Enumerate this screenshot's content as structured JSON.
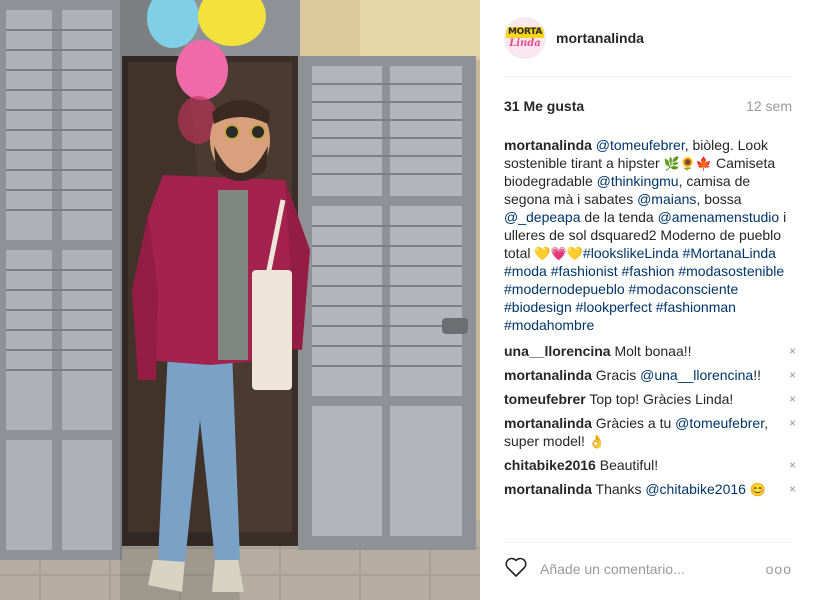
{
  "post": {
    "username": "mortanalinda",
    "avatar_top": "MORTA",
    "avatar_bottom": "Linda",
    "likes": "31 Me gusta",
    "age": "12 sem"
  },
  "caption": {
    "user": "mortanalinda",
    "m1": "@tomeufebrer",
    "t1": ", biòleg. Look sostenible tirant a hipster ",
    "e1": "🌿🌻🍁",
    "t2": " Camiseta biodegradable ",
    "m2": "@thinkingmu",
    "t3": ", camisa de segona mà i sabates ",
    "m3": "@maians",
    "t4": ", bossa ",
    "m4": "@_depeapa",
    "t5": " de la tenda ",
    "m5": "@amenamenstudio",
    "t6": " i ulleres de sol dsquared2 Moderno de pueblo total ",
    "e2": "💛💗💛",
    "tags": "#lookslikeLinda #MortanaLinda #moda #fashionist #fashion #modasostenible #modernodepueblo #modaconsciente #biodesign #lookperfect #fashionman #modahombre"
  },
  "comments": [
    {
      "user": "una__llorencina",
      "text": " Molt bonaa!!"
    },
    {
      "user": "mortanalinda",
      "text": " Gracis ",
      "mention": "@una__llorencina",
      "after": "!!"
    },
    {
      "user": "tomeufebrer",
      "text": " Top top! Gràcies Linda!"
    },
    {
      "user": "mortanalinda",
      "text": " Gràcies a tu ",
      "mention": "@tomeufebrer",
      "after": ", super model! ",
      "emoji": "👌"
    },
    {
      "user": "chitabike2016",
      "text": " Beautiful!"
    },
    {
      "user": "mortanalinda",
      "text": " Thanks ",
      "mention": "@chitabike2016",
      "emoji": "😊"
    }
  ],
  "close_symbol": "×",
  "input": {
    "placeholder": "Añade un comentario..."
  },
  "more_dots": "ooo",
  "colors": {
    "link": "#003569",
    "meta": "#999999",
    "divider": "#efefef",
    "heart": "#262626"
  }
}
